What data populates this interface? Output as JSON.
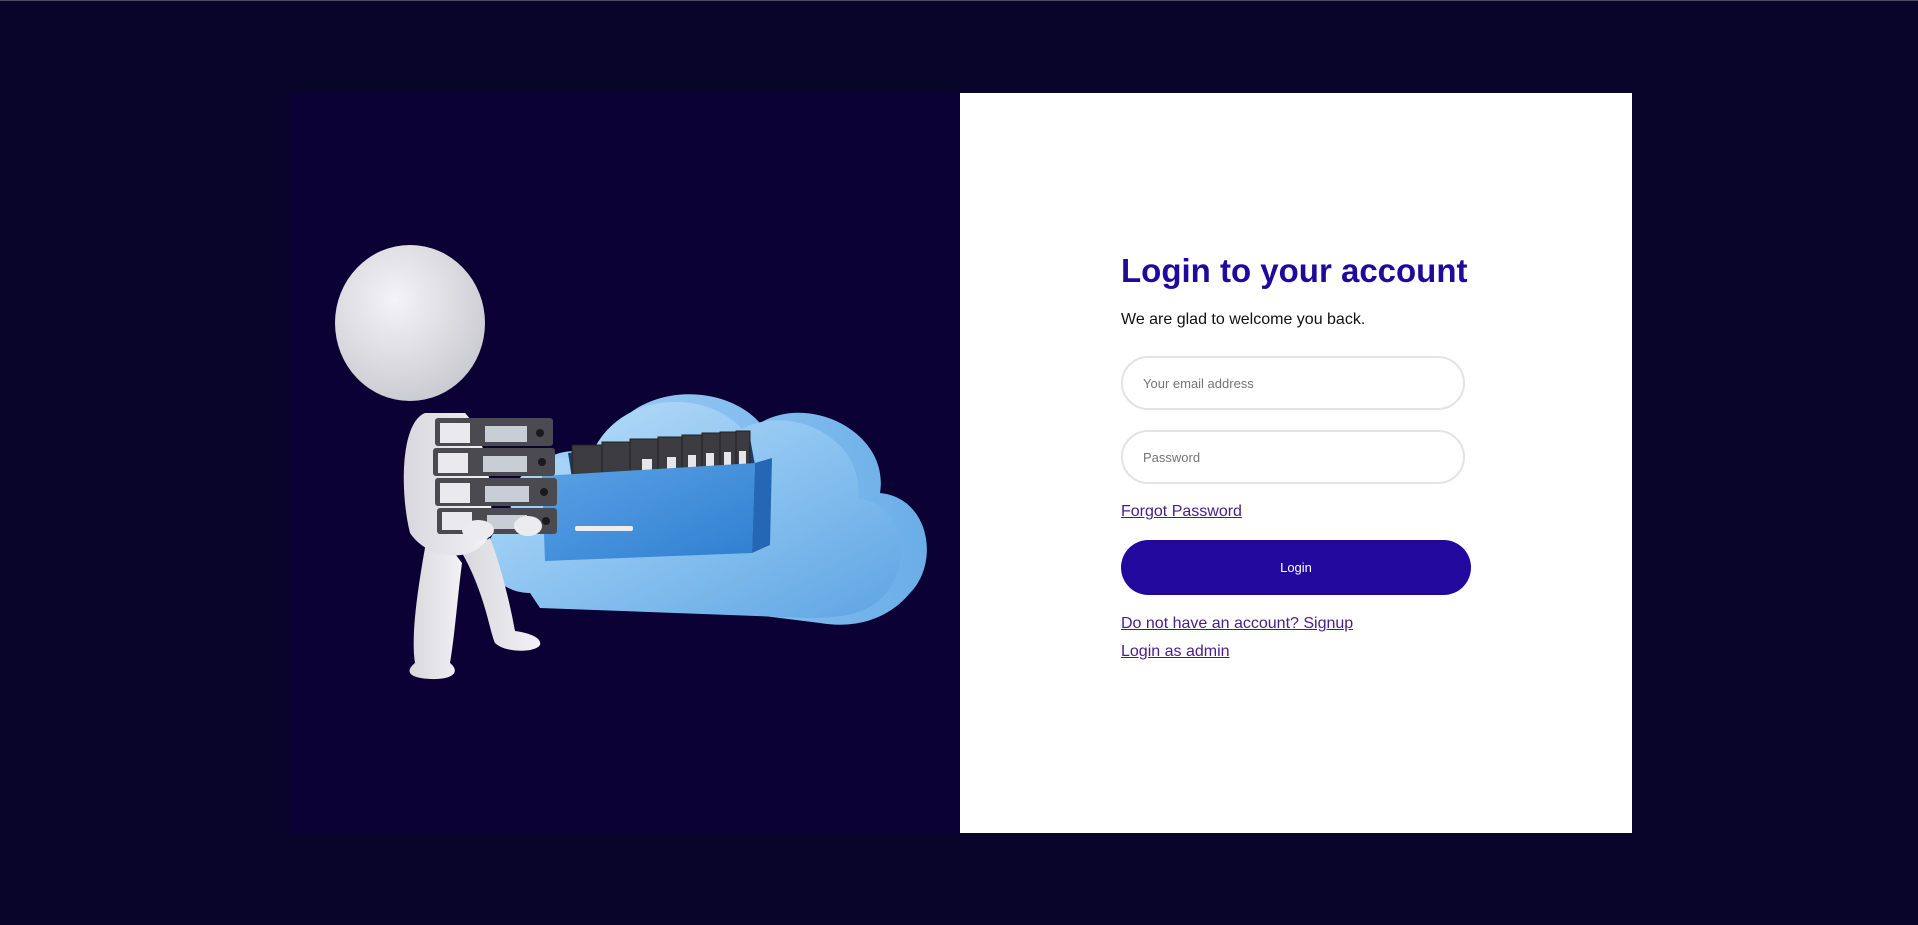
{
  "page": {
    "background_color": "#08042a",
    "accent_color": "#22089d",
    "title_color": "#1f0a9c",
    "link_color": "#4b1b8c"
  },
  "illustration": {
    "icon": "person-carrying-folders-to-cloud-cabinet-illustration"
  },
  "form": {
    "title": "Login to your account",
    "subtitle": "We are glad to welcome you back.",
    "email_placeholder": "Your email address",
    "email_value": "",
    "password_placeholder": "Password",
    "password_value": "",
    "forgot_password_label": "Forgot Password",
    "login_button_label": "Login",
    "signup_link_label": "Do not have an account? Signup",
    "admin_link_label": "Login as admin"
  }
}
